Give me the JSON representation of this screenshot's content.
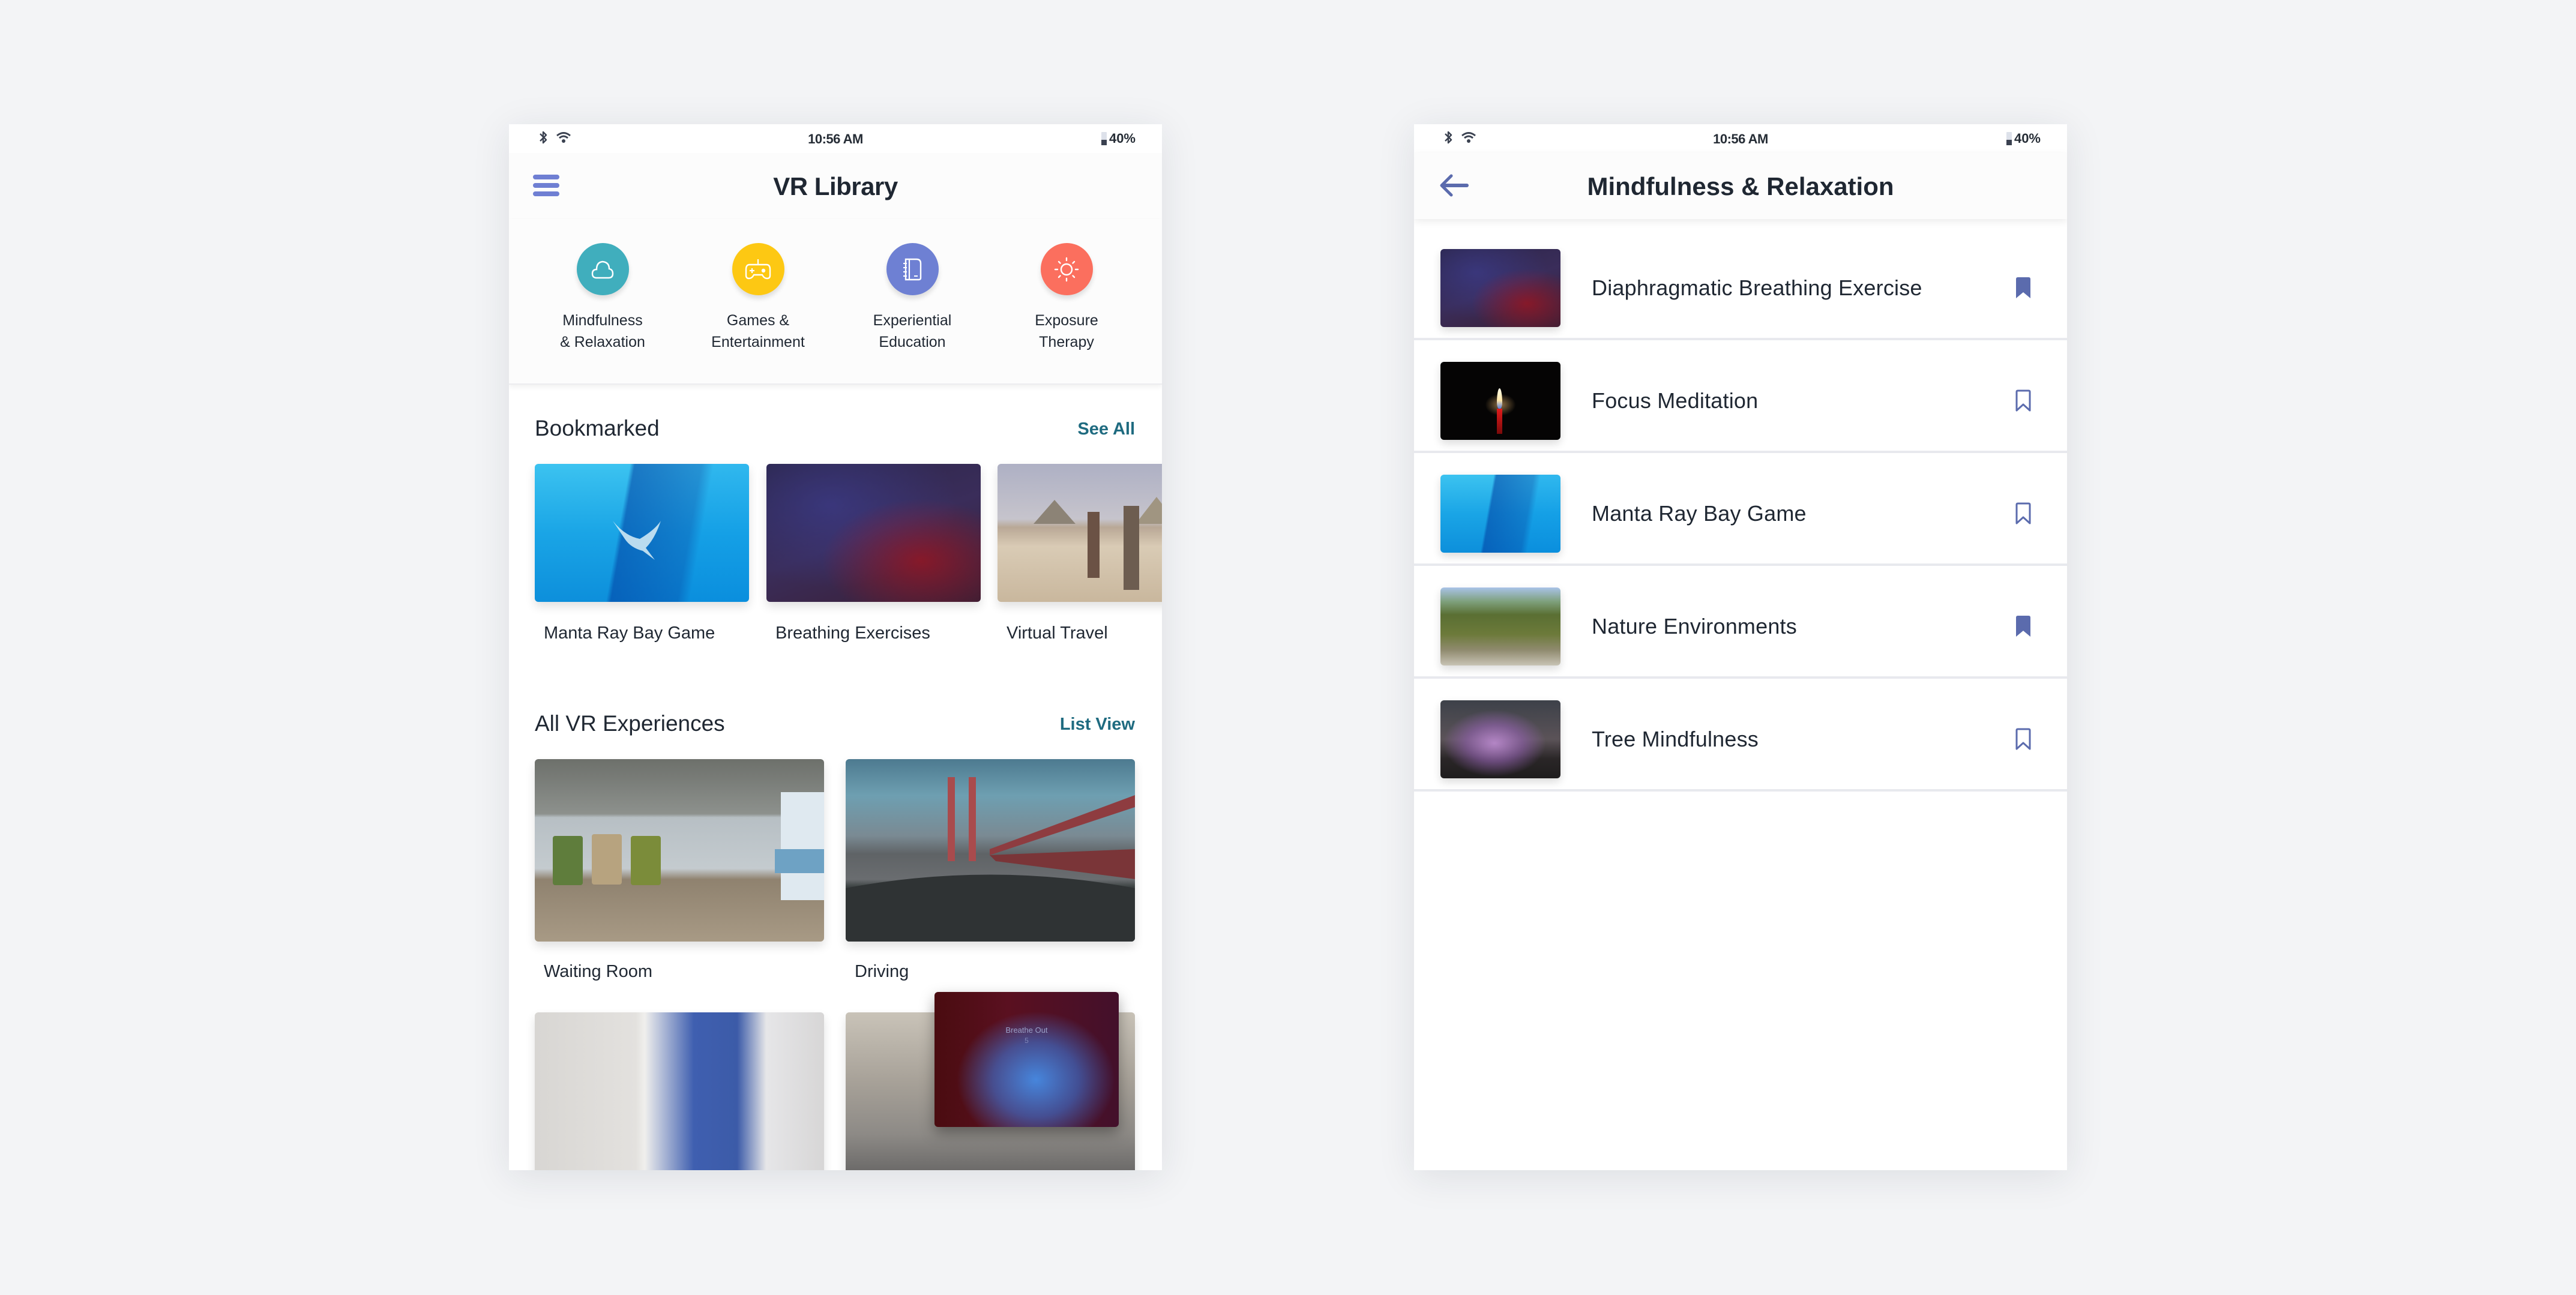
{
  "status_bar": {
    "time": "10:56 AM",
    "battery": "40%",
    "battery_level": 0.4
  },
  "library_screen": {
    "title": "VR Library",
    "menu_icon": "hamburger-menu-icon",
    "categories": [
      {
        "label_line1": "Mindfulness",
        "label_line2": "& Relaxation",
        "icon": "cloud-icon",
        "color": "#40aebd"
      },
      {
        "label_line1": "Games &",
        "label_line2": "Entertainment",
        "icon": "gamepad-icon",
        "color": "#fdc813"
      },
      {
        "label_line1": "Experiential",
        "label_line2": "Education",
        "icon": "notebook-icon",
        "color": "#6e80d3"
      },
      {
        "label_line1": "Exposure",
        "label_line2": "Therapy",
        "icon": "sun-icon",
        "color": "#fb6f5e"
      }
    ],
    "bookmarked": {
      "title": "Bookmarked",
      "link": "See All",
      "items": [
        {
          "label": "Manta Ray Bay Game"
        },
        {
          "label": "Breathing Exercises"
        },
        {
          "label": "Virtual Travel"
        }
      ]
    },
    "all_experiences": {
      "title": "All VR Experiences",
      "link": "List View",
      "items": [
        {
          "label": "Waiting Room"
        },
        {
          "label": "Driving"
        },
        {
          "label": ""
        },
        {
          "label": ""
        }
      ]
    },
    "drag_overlay": {
      "text": "Breathe Out",
      "count": "5"
    }
  },
  "category_screen": {
    "title": "Mindfulness & Relaxation",
    "back_icon": "arrow-left-icon",
    "items": [
      {
        "title": "Diaphragmatic Breathing Exercise",
        "bookmarked": true
      },
      {
        "title": "Focus Meditation",
        "bookmarked": false
      },
      {
        "title": "Manta Ray Bay Game",
        "bookmarked": false
      },
      {
        "title": "Nature Environments",
        "bookmarked": true
      },
      {
        "title": "Tree Mindfulness",
        "bookmarked": false
      }
    ]
  },
  "colors": {
    "accent": "#6f7fd3",
    "link": "#1f6b80",
    "bookmark": "#5b6bad",
    "text": "#1f2732",
    "background": "#f3f4f6"
  }
}
